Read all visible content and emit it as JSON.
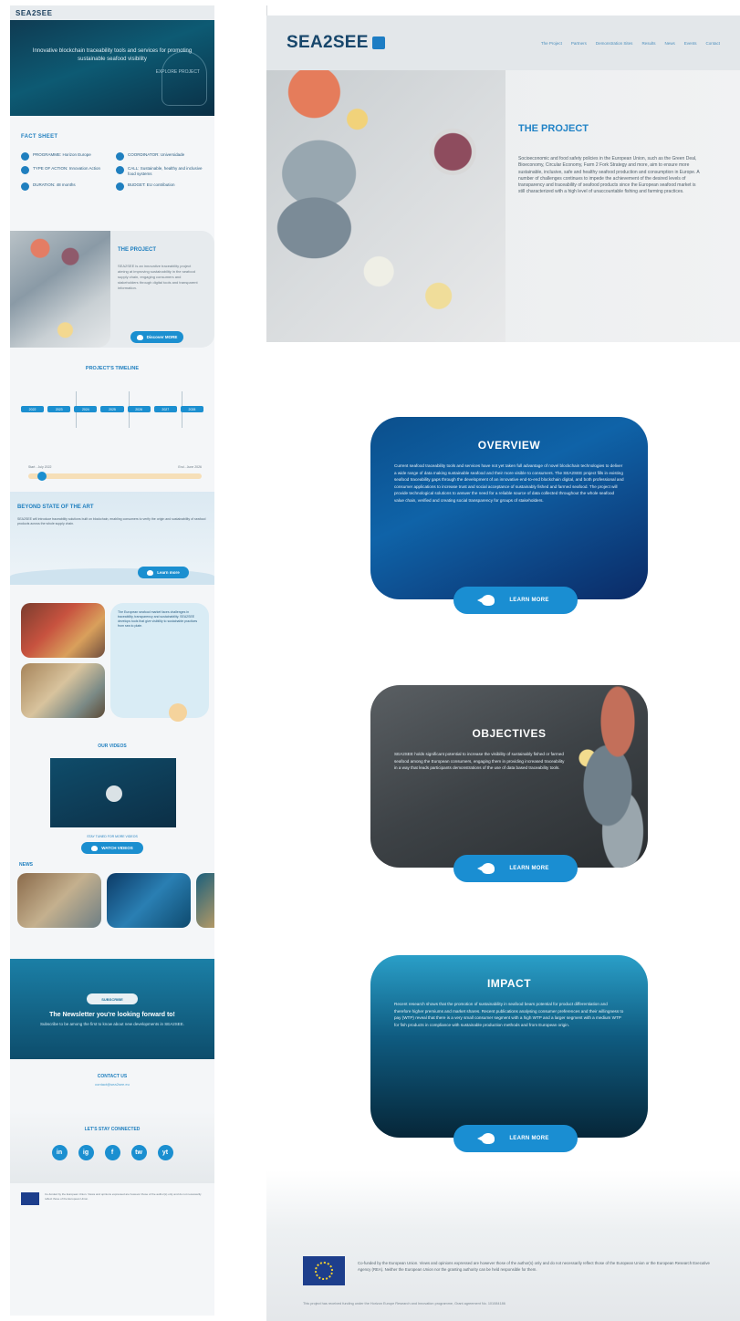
{
  "mobile": {
    "logo": "SEA2SEE",
    "hero": {
      "text": "Innovative blockchain traceability tools and services for promoting sustainable seafood visibility",
      "subtext": "EXPLORE PROJECT"
    },
    "fact_sheet": {
      "title": "FACT SHEET",
      "items": [
        {
          "label": "PROGRAMME: Horizon Europe"
        },
        {
          "label": "COORDINATOR: Universidade"
        },
        {
          "label": "TYPE OF ACTION: Innovation Action"
        },
        {
          "label": "CALL: Sustainable, healthy and inclusive food systems"
        },
        {
          "label": "DURATION: 48 months"
        },
        {
          "label": "BUDGET: EU contribution"
        }
      ]
    },
    "project": {
      "title": "THE PROJECT",
      "text": "SEA2SEE is an innovative traceability project aiming at improving sustainability in the seafood supply chain, engaging consumers and stakeholders through digital tools and transparent information.",
      "button": "Discover MORE"
    },
    "timeline": {
      "title": "PROJECT'S TIMELINE",
      "chips": [
        "2022",
        "2023",
        "2024",
        "2025",
        "2026",
        "2027",
        "2028"
      ],
      "start": "Start - July 2022",
      "end": "End - June 2026",
      "progress": 0.05
    },
    "beyond": {
      "title": "BEYOND STATE OF THE ART",
      "text": "SEA2SEE will introduce traceability solutions built on blockchain, enabling consumers to verify the origin and sustainability of seafood products across the whole supply chain.",
      "button": "Learn more"
    },
    "gallery_text": "The European seafood market faces challenges in traceability, transparency and sustainability. SEA2SEE develops tools that give visibility to sustainable practices from sea to plate.",
    "videos": {
      "title": "OUR VIDEOS",
      "subtitle": "STAY TUNED FOR MORE VIDEOS",
      "button": "WATCH VIDEOS"
    },
    "news": {
      "title": "NEWS"
    },
    "newsletter": {
      "button": "SUBSCRIBE",
      "title": "The Newsletter you're looking forward to!",
      "subtitle": "Subscribe to be among the first to know about new developments in SEA2SEE."
    },
    "contact": {
      "title": "CONTACT US",
      "email": "contact@sea2see.eu"
    },
    "social": {
      "title": "LET'S STAY CONNECTED",
      "icons": [
        "in",
        "ig",
        "f",
        "tw",
        "yt"
      ]
    },
    "footer": "Co-funded by the European Union. Views and opinions expressed are however those of the author(s) only and do not necessarily reflect those of the European Union."
  },
  "desktop": {
    "logo": "SEA2SEE",
    "nav": [
      "The Project",
      "Partners",
      "Demonstration Sites",
      "Results",
      "News",
      "Events",
      "Contact"
    ],
    "hero": {
      "title": "THE PROJECT",
      "text": "Socioeconomic and food safety policies in the European Union, such as the Green Deal, Bioeconomy, Circular Economy, Farm 2 Fork Strategy and more, aim to ensure more sustainable, inclusive, safe and healthy seafood production and consumption in Europe. A number of challenges continues to impede the achievement of the desired levels of transparency and traceability of seafood products since the European seafood market is still characterized with a high level of unaccountable fishing and farming practices."
    },
    "cards": [
      {
        "title": "OVERVIEW",
        "text": "Current seafood traceability tools and services have not yet taken full advantage of novel blockchain technologies to deliver a wide range of data making sustainable seafood and their more visible to consumers. The SEA2SEE project fills in existing seafood traceability gaps through the development of an innovative end-to-end blockchain digital, and both professional and consumer applications to increase trust and social acceptance of sustainably fished and farmed seafood. The project will provide technological solutions to answer the need for a reliable source of data collected throughout the whole seafood value chain, verified and creating social transparency for groups of stakeholders.",
        "button": "LEARN MORE"
      },
      {
        "title": "OBJECTIVES",
        "text": "SEA2SEE holds significant potential to increase the visibility of sustainably fished or farmed seafood among the European consumers, engaging them in providing increased traceability in a way that leads participants demonstrations of the use of data based traceability tools.",
        "button": "LEARN MORE"
      },
      {
        "title": "IMPACT",
        "text": "Recent research shows that the promotion of sustainability in seafood bears potential for product differentiation and therefore higher premiums and market shares. Recent publications analysing consumer preferences and their willingness to pay (WTP) reveal that there is a very small consumer segment with a high WTP and a larger segment with a medium WTP for fish products in compliance with sustainable production methods and from European origin.",
        "button": "LEARN MORE"
      }
    ],
    "footer": {
      "text": "Co-funded by the European Union. Views and opinions expressed are however those of the author(s) only and do not necessarily reflect those of the European Union or the European Research Executive Agency (REA). Neither the European Union nor the granting authority can be held responsible for them.",
      "small": "This project has received funding under the Horizon Europe Research and Innovation programme, Grant agreement No. 101084186"
    }
  },
  "colors": {
    "accent": "#1a8ed2",
    "brand": "#17466b",
    "title_blue": "#2183c6"
  }
}
